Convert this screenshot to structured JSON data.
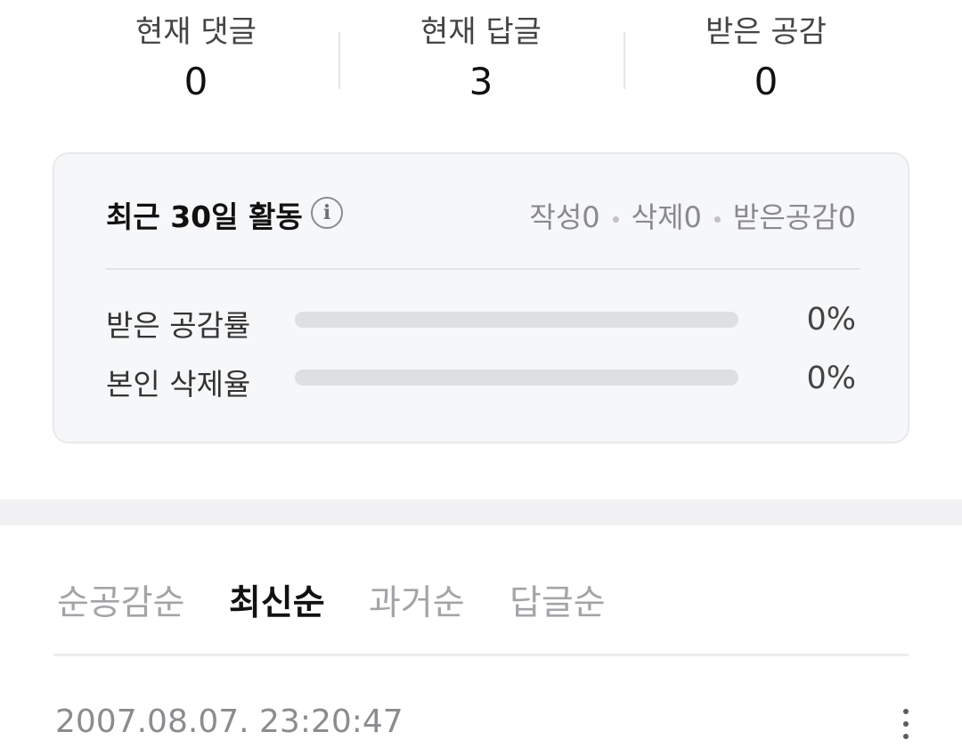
{
  "stats": {
    "comments": {
      "label": "현재 댓글",
      "value": "0"
    },
    "replies": {
      "label": "현재 답글",
      "value": "3"
    },
    "likes": {
      "label": "받은 공감",
      "value": "0"
    }
  },
  "activity": {
    "title": "최근 30일 활동",
    "info_icon": "i",
    "summary": {
      "written": "작성0",
      "deleted": "삭제0",
      "likes": "받은공감0"
    },
    "metrics": [
      {
        "label": "받은 공감률",
        "value": "0%",
        "fraction": 0
      },
      {
        "label": "본인 삭제율",
        "value": "0%",
        "fraction": 0
      }
    ],
    "bar_fill_color": "#4d7ef7"
  },
  "sort_tabs": {
    "items": [
      "순공감순",
      "최신순",
      "과거순",
      "답글순"
    ],
    "active": "최신순"
  },
  "list": {
    "first_item": {
      "timestamp": "2007.08.07. 23:20:47",
      "menu_icon": "more-vertical-icon"
    }
  }
}
